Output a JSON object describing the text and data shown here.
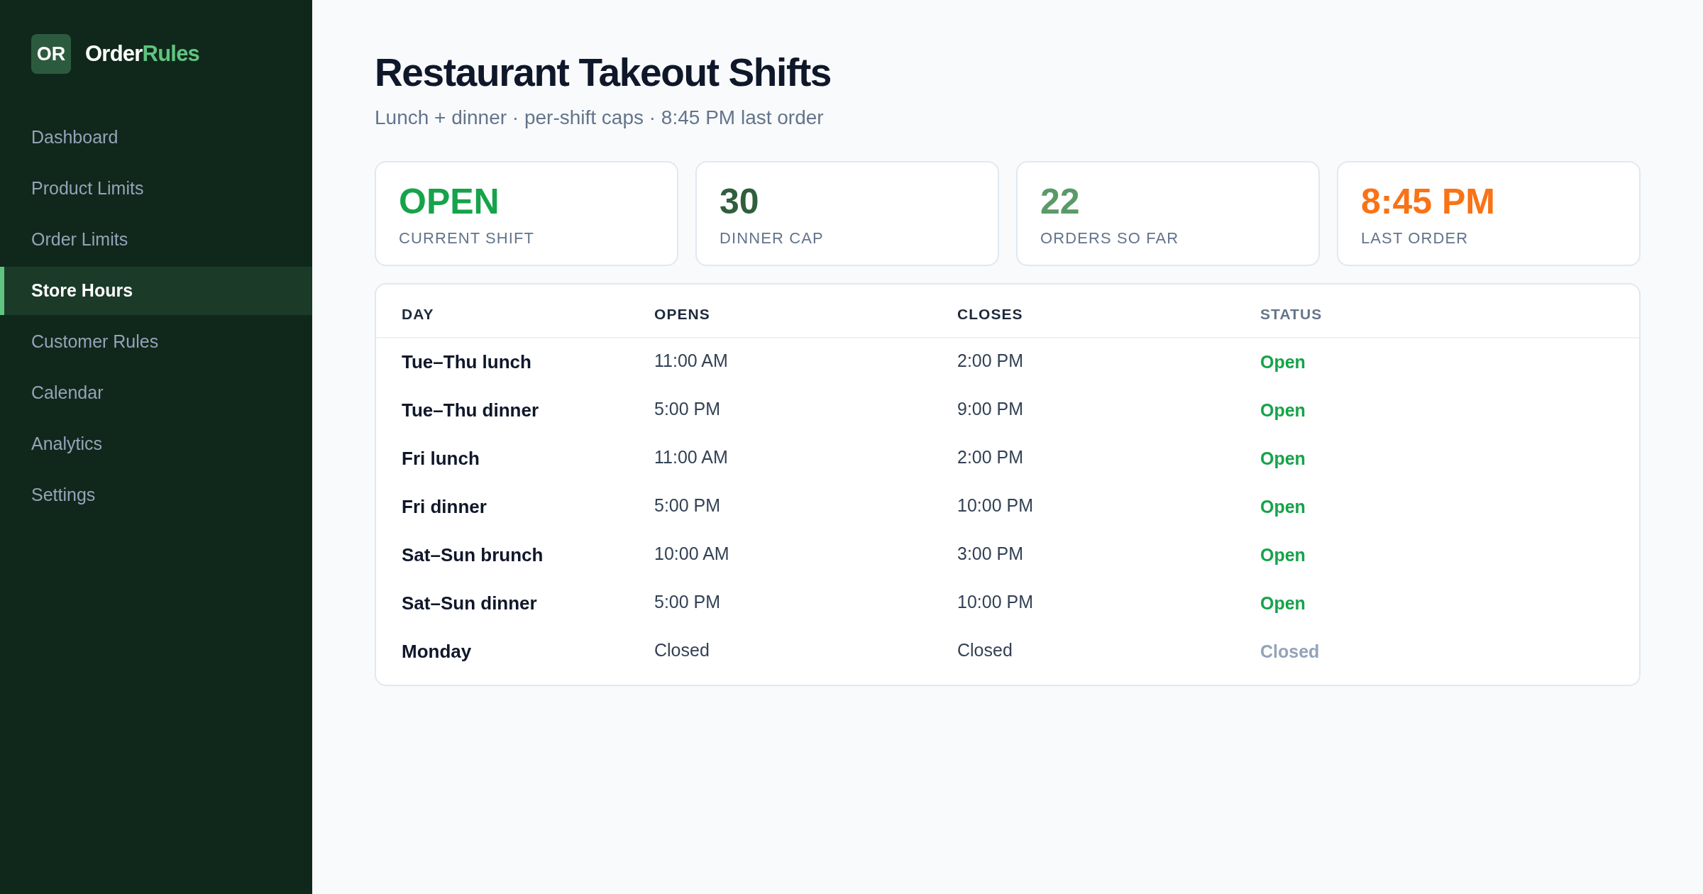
{
  "brand": {
    "badge": "OR",
    "name_part_1": "Order",
    "name_part_2": "Rules"
  },
  "sidebar": {
    "items": [
      {
        "label": "Dashboard",
        "selected": false
      },
      {
        "label": "Product Limits",
        "selected": false
      },
      {
        "label": "Order Limits",
        "selected": false
      },
      {
        "label": "Store Hours",
        "selected": true
      },
      {
        "label": "Customer Rules",
        "selected": false
      },
      {
        "label": "Calendar",
        "selected": false
      },
      {
        "label": "Analytics",
        "selected": false
      },
      {
        "label": "Settings",
        "selected": false
      }
    ]
  },
  "header": {
    "title": "Restaurant Takeout Shifts",
    "subtitle": "Lunch + dinner · per-shift caps · 8:45 PM last order"
  },
  "stats": [
    {
      "value": "OPEN",
      "label": "CURRENT SHIFT",
      "color": "#16a34a"
    },
    {
      "value": "30",
      "label": "DINNER CAP",
      "color": "#2f5f3c"
    },
    {
      "value": "22",
      "label": "ORDERS SO FAR",
      "color": "#5a9a68"
    },
    {
      "value": "8:45 PM",
      "label": "LAST ORDER",
      "color": "#f97316"
    }
  ],
  "table": {
    "columns": [
      "DAY",
      "OPENS",
      "CLOSES",
      "STATUS"
    ],
    "rows": [
      {
        "day": "Tue–Thu lunch",
        "opens": "11:00 AM",
        "closes": "2:00 PM",
        "status": "Open",
        "kind": "open"
      },
      {
        "day": "Tue–Thu dinner",
        "opens": "5:00 PM",
        "closes": "9:00 PM",
        "status": "Open",
        "kind": "open"
      },
      {
        "day": "Fri lunch",
        "opens": "11:00 AM",
        "closes": "2:00 PM",
        "status": "Open",
        "kind": "open"
      },
      {
        "day": "Fri dinner",
        "opens": "5:00 PM",
        "closes": "10:00 PM",
        "status": "Open",
        "kind": "open"
      },
      {
        "day": "Sat–Sun brunch",
        "opens": "10:00 AM",
        "closes": "3:00 PM",
        "status": "Open",
        "kind": "open"
      },
      {
        "day": "Sat–Sun dinner",
        "opens": "5:00 PM",
        "closes": "10:00 PM",
        "status": "Open",
        "kind": "open"
      },
      {
        "day": "Monday",
        "opens": "Closed",
        "closes": "Closed",
        "status": "Closed",
        "kind": "closed"
      }
    ]
  }
}
